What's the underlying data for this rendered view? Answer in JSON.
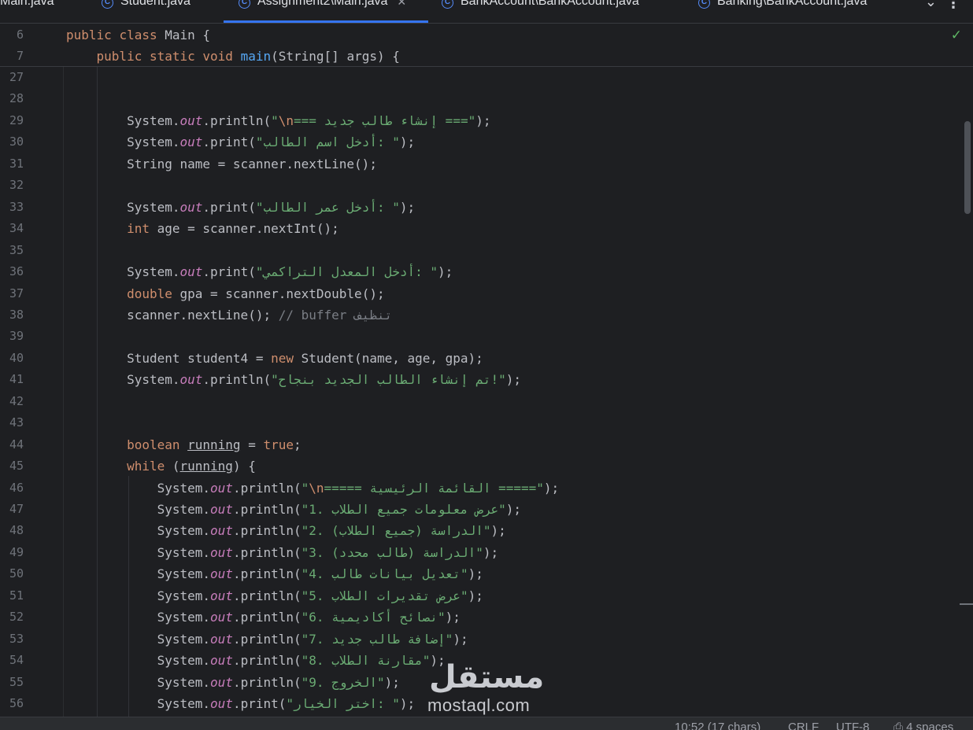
{
  "tabs": [
    {
      "label": "Main.java",
      "icon": "class-icon",
      "active": false
    },
    {
      "label": "Student.java",
      "icon": "class-icon",
      "active": false
    },
    {
      "label": "Assignment2\\Main.java",
      "icon": "class-icon",
      "active": true
    },
    {
      "label": "BankAccount\\BankAccount.java",
      "icon": "class-icon",
      "active": false
    },
    {
      "label": "Banking\\BankAccount.java",
      "icon": "class-icon",
      "active": false
    }
  ],
  "editor": {
    "sticky_lines": [
      {
        "num": "6",
        "tokens": [
          [
            "kw",
            "public "
          ],
          [
            "kw",
            "class "
          ],
          [
            "",
            "Main {"
          ]
        ]
      },
      {
        "num": "7",
        "tokens": [
          [
            "",
            "    "
          ],
          [
            "kw",
            "public "
          ],
          [
            "kw",
            "static "
          ],
          [
            "kw",
            "void "
          ],
          [
            "fn",
            "main"
          ],
          [
            "",
            "(String[] args) {"
          ]
        ]
      }
    ],
    "lines": [
      {
        "num": "27",
        "tokens": []
      },
      {
        "num": "28",
        "tokens": []
      },
      {
        "num": "29",
        "tokens": [
          [
            "",
            "        System."
          ],
          [
            "fld",
            "out"
          ],
          [
            "",
            ".println("
          ],
          [
            "str",
            "\""
          ],
          [
            "esc",
            "\\n"
          ],
          [
            "str",
            "=== إنشاء طالب جديد ===\""
          ],
          [
            "",
            ");"
          ]
        ]
      },
      {
        "num": "30",
        "tokens": [
          [
            "",
            "        System."
          ],
          [
            "fld",
            "out"
          ],
          [
            "",
            ".print("
          ],
          [
            "str",
            "\"أدخل اسم الطالب: \""
          ],
          [
            "",
            ");"
          ]
        ]
      },
      {
        "num": "31",
        "tokens": [
          [
            "",
            "        String name = scanner.nextLine();"
          ]
        ]
      },
      {
        "num": "32",
        "tokens": []
      },
      {
        "num": "33",
        "tokens": [
          [
            "",
            "        System."
          ],
          [
            "fld",
            "out"
          ],
          [
            "",
            ".print("
          ],
          [
            "str",
            "\"أدخل عمر الطالب: \""
          ],
          [
            "",
            ");"
          ]
        ]
      },
      {
        "num": "34",
        "tokens": [
          [
            "",
            "        "
          ],
          [
            "kw",
            "int "
          ],
          [
            "",
            "age = scanner.nextInt();"
          ]
        ]
      },
      {
        "num": "35",
        "tokens": []
      },
      {
        "num": "36",
        "tokens": [
          [
            "",
            "        System."
          ],
          [
            "fld",
            "out"
          ],
          [
            "",
            ".print("
          ],
          [
            "str",
            "\"أدخل المعدل التراكمي: \""
          ],
          [
            "",
            ");"
          ]
        ]
      },
      {
        "num": "37",
        "tokens": [
          [
            "",
            "        "
          ],
          [
            "kw",
            "double "
          ],
          [
            "",
            "gpa = scanner.nextDouble();"
          ]
        ]
      },
      {
        "num": "38",
        "tokens": [
          [
            "",
            "        scanner.nextLine(); "
          ],
          [
            "cm",
            "// buffer تنظيف"
          ]
        ]
      },
      {
        "num": "39",
        "tokens": []
      },
      {
        "num": "40",
        "tokens": [
          [
            "",
            "        Student student4 = "
          ],
          [
            "kw",
            "new "
          ],
          [
            "",
            "Student(name, age, gpa);"
          ]
        ]
      },
      {
        "num": "41",
        "tokens": [
          [
            "",
            "        System."
          ],
          [
            "fld",
            "out"
          ],
          [
            "",
            ".println("
          ],
          [
            "str",
            "\"تم إنشاء الطالب الجديد بنجاح!\""
          ],
          [
            "",
            ");"
          ]
        ]
      },
      {
        "num": "42",
        "tokens": []
      },
      {
        "num": "43",
        "tokens": []
      },
      {
        "num": "44",
        "tokens": [
          [
            "",
            "        "
          ],
          [
            "kw",
            "boolean "
          ],
          [
            "var",
            "running"
          ],
          [
            "",
            " = "
          ],
          [
            "kw",
            "true"
          ],
          [
            "",
            ";"
          ]
        ]
      },
      {
        "num": "45",
        "tokens": [
          [
            "",
            "        "
          ],
          [
            "kw",
            "while "
          ],
          [
            "",
            "("
          ],
          [
            "var",
            "running"
          ],
          [
            "",
            ") {"
          ]
        ]
      },
      {
        "num": "46",
        "tokens": [
          [
            "",
            "            System."
          ],
          [
            "fld",
            "out"
          ],
          [
            "",
            ".println("
          ],
          [
            "str",
            "\""
          ],
          [
            "esc",
            "\\n"
          ],
          [
            "str",
            "===== القائمة الرئيسية =====\""
          ],
          [
            "",
            ");"
          ]
        ]
      },
      {
        "num": "47",
        "tokens": [
          [
            "",
            "            System."
          ],
          [
            "fld",
            "out"
          ],
          [
            "",
            ".println("
          ],
          [
            "str",
            "\"1. عرض معلومات جميع الطلاب\""
          ],
          [
            "",
            ");"
          ]
        ]
      },
      {
        "num": "48",
        "tokens": [
          [
            "",
            "            System."
          ],
          [
            "fld",
            "out"
          ],
          [
            "",
            ".println("
          ],
          [
            "str",
            "\"2. الدراسة (جميع الطلاب)\""
          ],
          [
            "",
            ");"
          ]
        ]
      },
      {
        "num": "49",
        "tokens": [
          [
            "",
            "            System."
          ],
          [
            "fld",
            "out"
          ],
          [
            "",
            ".println("
          ],
          [
            "str",
            "\"3. الدراسة (طالب محدد)\""
          ],
          [
            "",
            ");"
          ]
        ]
      },
      {
        "num": "50",
        "tokens": [
          [
            "",
            "            System."
          ],
          [
            "fld",
            "out"
          ],
          [
            "",
            ".println("
          ],
          [
            "str",
            "\"4. تعديل بيانات طالب\""
          ],
          [
            "",
            ");"
          ]
        ]
      },
      {
        "num": "51",
        "tokens": [
          [
            "",
            "            System."
          ],
          [
            "fld",
            "out"
          ],
          [
            "",
            ".println("
          ],
          [
            "str",
            "\"5. عرض تقديرات الطلاب\""
          ],
          [
            "",
            ");"
          ]
        ]
      },
      {
        "num": "52",
        "tokens": [
          [
            "",
            "            System."
          ],
          [
            "fld",
            "out"
          ],
          [
            "",
            ".println("
          ],
          [
            "str",
            "\"6. نصائح أكاديمية\""
          ],
          [
            "",
            ");"
          ]
        ]
      },
      {
        "num": "53",
        "tokens": [
          [
            "",
            "            System."
          ],
          [
            "fld",
            "out"
          ],
          [
            "",
            ".println("
          ],
          [
            "str",
            "\"7. إضافة طالب جديد\""
          ],
          [
            "",
            ");"
          ]
        ]
      },
      {
        "num": "54",
        "tokens": [
          [
            "",
            "            System."
          ],
          [
            "fld",
            "out"
          ],
          [
            "",
            ".println("
          ],
          [
            "str",
            "\"8. مقارنة الطلاب\""
          ],
          [
            "",
            ");"
          ]
        ]
      },
      {
        "num": "55",
        "tokens": [
          [
            "",
            "            System."
          ],
          [
            "fld",
            "out"
          ],
          [
            "",
            ".println("
          ],
          [
            "str",
            "\"9. الخروج\""
          ],
          [
            "",
            ");"
          ]
        ]
      },
      {
        "num": "56",
        "tokens": [
          [
            "",
            "            System."
          ],
          [
            "fld",
            "out"
          ],
          [
            "",
            ".print("
          ],
          [
            "str",
            "\"اختر الخيار: \""
          ],
          [
            "",
            ");"
          ]
        ]
      }
    ]
  },
  "watermark": {
    "arabic": "مستقل",
    "latin": "mostaql.com"
  },
  "status": {
    "position": "10:52 (17 chars)",
    "line_sep": "CRLF",
    "encoding": "UTF-8",
    "indent": "4 spaces"
  },
  "colors": {
    "background": "#1e1f22",
    "keyword": "#cf8e6d",
    "string": "#6aab73",
    "function": "#56a8f5",
    "static_field": "#c77dbb",
    "comment": "#7a7e85",
    "accent": "#3574f0"
  }
}
